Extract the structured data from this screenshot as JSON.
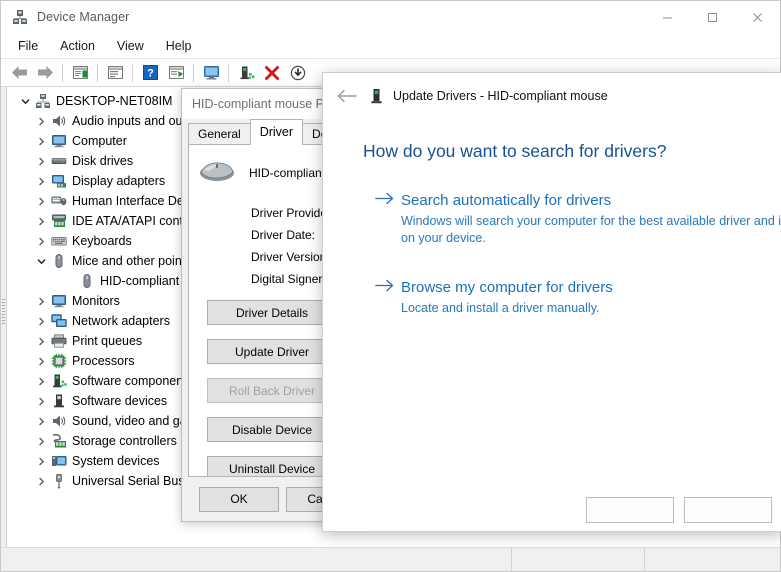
{
  "device_manager": {
    "title": "Device Manager",
    "title_icon": "device-manager-icon",
    "window_buttons": {
      "minimize": "—",
      "maximize": "☐",
      "close": "✕"
    },
    "menu": [
      "File",
      "Action",
      "View",
      "Help"
    ],
    "toolbar": [
      {
        "name": "back-icon",
        "glyph": "←"
      },
      {
        "name": "forward-icon",
        "glyph": "→"
      },
      {
        "name": "properties-icon",
        "glyph": "▤"
      },
      {
        "name": "show-hidden-icon",
        "glyph": "▥"
      },
      {
        "name": "help-icon",
        "glyph": "?"
      },
      {
        "name": "update-driver-icon",
        "glyph": "▶"
      },
      {
        "name": "scan-hardware-icon",
        "glyph": "Ὓ5"
      },
      {
        "name": "add-driver-icon",
        "glyph": "▮"
      },
      {
        "name": "uninstall-device-icon",
        "glyph": "✕"
      },
      {
        "name": "disable-device-icon",
        "glyph": "↓"
      }
    ],
    "tree": {
      "root": {
        "label": "DESKTOP-NET08IM",
        "icon": "computer-root-icon",
        "expanded": true
      },
      "items": [
        {
          "label": "Audio inputs and out",
          "icon": "speaker-icon",
          "expanded": false
        },
        {
          "label": "Computer",
          "icon": "monitor-icon",
          "expanded": false
        },
        {
          "label": "Disk drives",
          "icon": "disk-icon",
          "expanded": false
        },
        {
          "label": "Display adapters",
          "icon": "display-adapter-icon",
          "expanded": false
        },
        {
          "label": "Human Interface Dev",
          "icon": "hid-icon",
          "expanded": false
        },
        {
          "label": "IDE ATA/ATAPI contr",
          "icon": "ide-controller-icon",
          "expanded": false
        },
        {
          "label": "Keyboards",
          "icon": "keyboard-icon",
          "expanded": false
        },
        {
          "label": "Mice and other point",
          "icon": "mouse-icon",
          "expanded": true
        },
        {
          "label": "Monitors",
          "icon": "monitor-icon",
          "expanded": false
        },
        {
          "label": "Network adapters",
          "icon": "network-icon",
          "expanded": false
        },
        {
          "label": "Print queues",
          "icon": "printer-icon",
          "expanded": false
        },
        {
          "label": "Processors",
          "icon": "processor-icon",
          "expanded": false
        },
        {
          "label": "Software component",
          "icon": "software-component-icon",
          "expanded": false
        },
        {
          "label": "Software devices",
          "icon": "software-device-icon",
          "expanded": false
        },
        {
          "label": "Sound, video and ga",
          "icon": "speaker-icon",
          "expanded": false
        },
        {
          "label": "Storage controllers",
          "icon": "storage-controller-icon",
          "expanded": false
        },
        {
          "label": "System devices",
          "icon": "system-device-icon",
          "expanded": false
        },
        {
          "label": "Universal Serial Bus c",
          "icon": "usb-icon",
          "expanded": false
        }
      ],
      "child": {
        "label": "HID-compliant m",
        "icon": "mouse-icon",
        "parent_index": 7
      }
    }
  },
  "properties_dialog": {
    "title": "HID-compliant mouse Pr",
    "tabs": [
      {
        "label": "General",
        "active": false
      },
      {
        "label": "Driver",
        "active": true
      },
      {
        "label": "Details",
        "active": false
      }
    ],
    "device_icon": "mouse-large-icon",
    "device_name": "HID-compliant m",
    "fields": [
      "Driver Provider:",
      "Driver Date:",
      "Driver Version:",
      "Digital Signer:"
    ],
    "buttons": [
      {
        "label": "Driver Details",
        "disabled": false
      },
      {
        "label": "Update Driver",
        "disabled": false
      },
      {
        "label": "Roll Back Driver",
        "disabled": true
      },
      {
        "label": "Disable Device",
        "disabled": false
      },
      {
        "label": "Uninstall Device",
        "disabled": false
      }
    ],
    "footer_buttons": [
      "OK",
      "Cancel"
    ]
  },
  "update_drivers_wizard": {
    "back_icon": "back-arrow-icon",
    "device_icon": "device-icon",
    "title": "Update Drivers - HID-compliant mouse",
    "question": "How do you want to search for drivers?",
    "options": [
      {
        "arrow": "→",
        "heading": "Search automatically for drivers",
        "description": "Windows will search your computer for the best available driver and install it on your device."
      },
      {
        "arrow": "→",
        "heading": "Browse my computer for drivers",
        "description": "Locate and install a driver manually."
      }
    ],
    "footer_buttons": [
      "",
      ""
    ]
  },
  "colors": {
    "accent_blue": "#1e6fba",
    "heading_blue": "#17518f",
    "close_red": "#e81123",
    "toolbar_red": "#d11a1a",
    "chrome_gray": "#f0f0f0"
  }
}
